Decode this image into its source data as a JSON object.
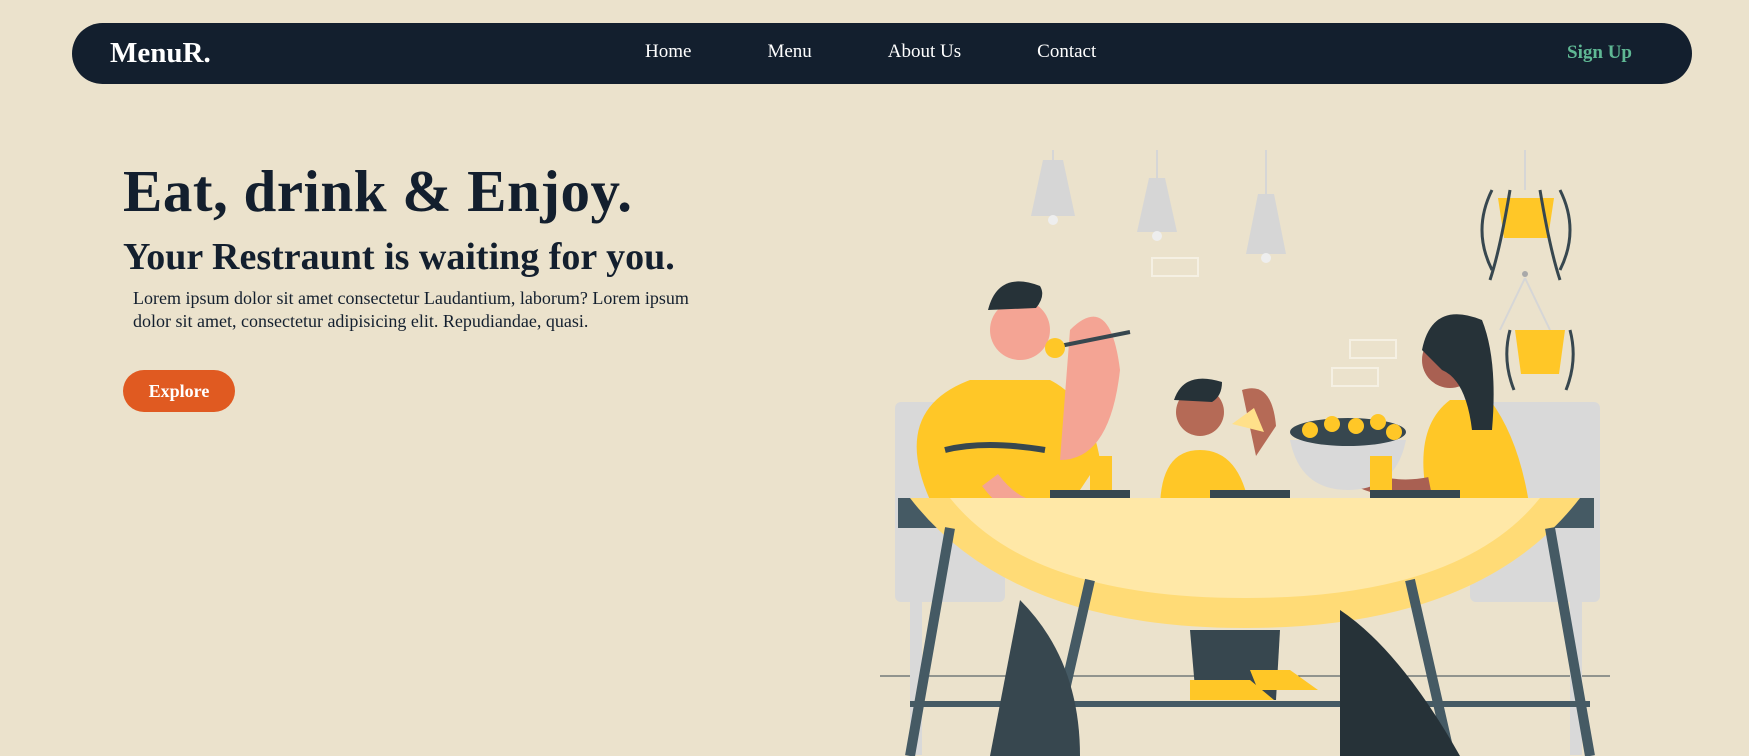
{
  "header": {
    "logo": "MenuR.",
    "nav": [
      {
        "label": "Home"
      },
      {
        "label": "Menu"
      },
      {
        "label": "About Us"
      },
      {
        "label": "Contact"
      }
    ],
    "signup_label": "Sign Up"
  },
  "hero": {
    "title": "Eat, drink & Enjoy.",
    "subtitle": "Your Restraunt is waiting for you.",
    "body": "Lorem ipsum dolor sit amet consectetur Laudantium, laborum? Lorem ipsum dolor sit amet, consectetur adipisicing elit. Repudiandae, quasi.",
    "cta_label": "Explore"
  },
  "colors": {
    "background": "#ebe2cc",
    "nav_bg": "#131f2e",
    "accent_green": "#5fb894",
    "cta": "#e05a21",
    "illustration_yellow": "#ffc727"
  }
}
